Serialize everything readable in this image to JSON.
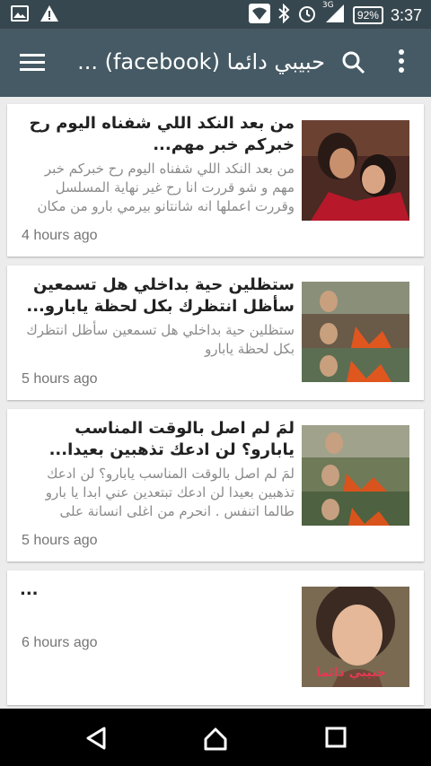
{
  "status_bar": {
    "network": "3G",
    "battery": "92%",
    "time": "3:37",
    "icons": [
      "image-icon",
      "warning-icon",
      "wifi-icon",
      "bluetooth-icon",
      "alarm-icon",
      "signal-icon"
    ]
  },
  "app_bar": {
    "title": "حبيبي دائما (facebook) ...",
    "icons": [
      "menu-icon",
      "search-icon",
      "more-vert-icon"
    ]
  },
  "posts": [
    {
      "headline": "من بعد النكد اللي شفناه اليوم رح خبركم خبر مهم...",
      "snippet": "من بعد النكد اللي شفناه اليوم رح خبركم خبر مهم و شو قررت انا رح غير نهاية المسلسل وقررت اعملها انه شانتانو بيرمي بارو من مكان",
      "time": "4 hours ago"
    },
    {
      "headline": "ستظلين حية بداخلي هل تسمعين سأظل انتظرك بكل لحظة يابارو...",
      "snippet": "ستظلين حية بداخلي هل تسمعين سأظل انتظرك بكل لحظة يابارو",
      "time": "5 hours ago"
    },
    {
      "headline": "لمَ لم اصل بالوقت المناسب يابارو؟ لن ادعك تذهبين بعيدا...",
      "snippet": "لمَ لم اصل بالوقت المناسب يابارو؟ لن ادعك تذهبين بعيدا لن ادعك تبتعدين عني ابدا يا بارو طالما اتنفس . انحرم من اغلى انسانة على",
      "time": "5 hours ago"
    },
    {
      "headline": "...",
      "snippet": "",
      "time": "6 hours ago",
      "thumb_caption": "حبيبي دائما"
    }
  ],
  "nav_bar": {
    "icons": [
      "back-icon",
      "home-icon",
      "recents-icon"
    ]
  },
  "colors": {
    "status_bar": "#37474f",
    "app_bar": "#455a64",
    "background": "#ececec"
  }
}
